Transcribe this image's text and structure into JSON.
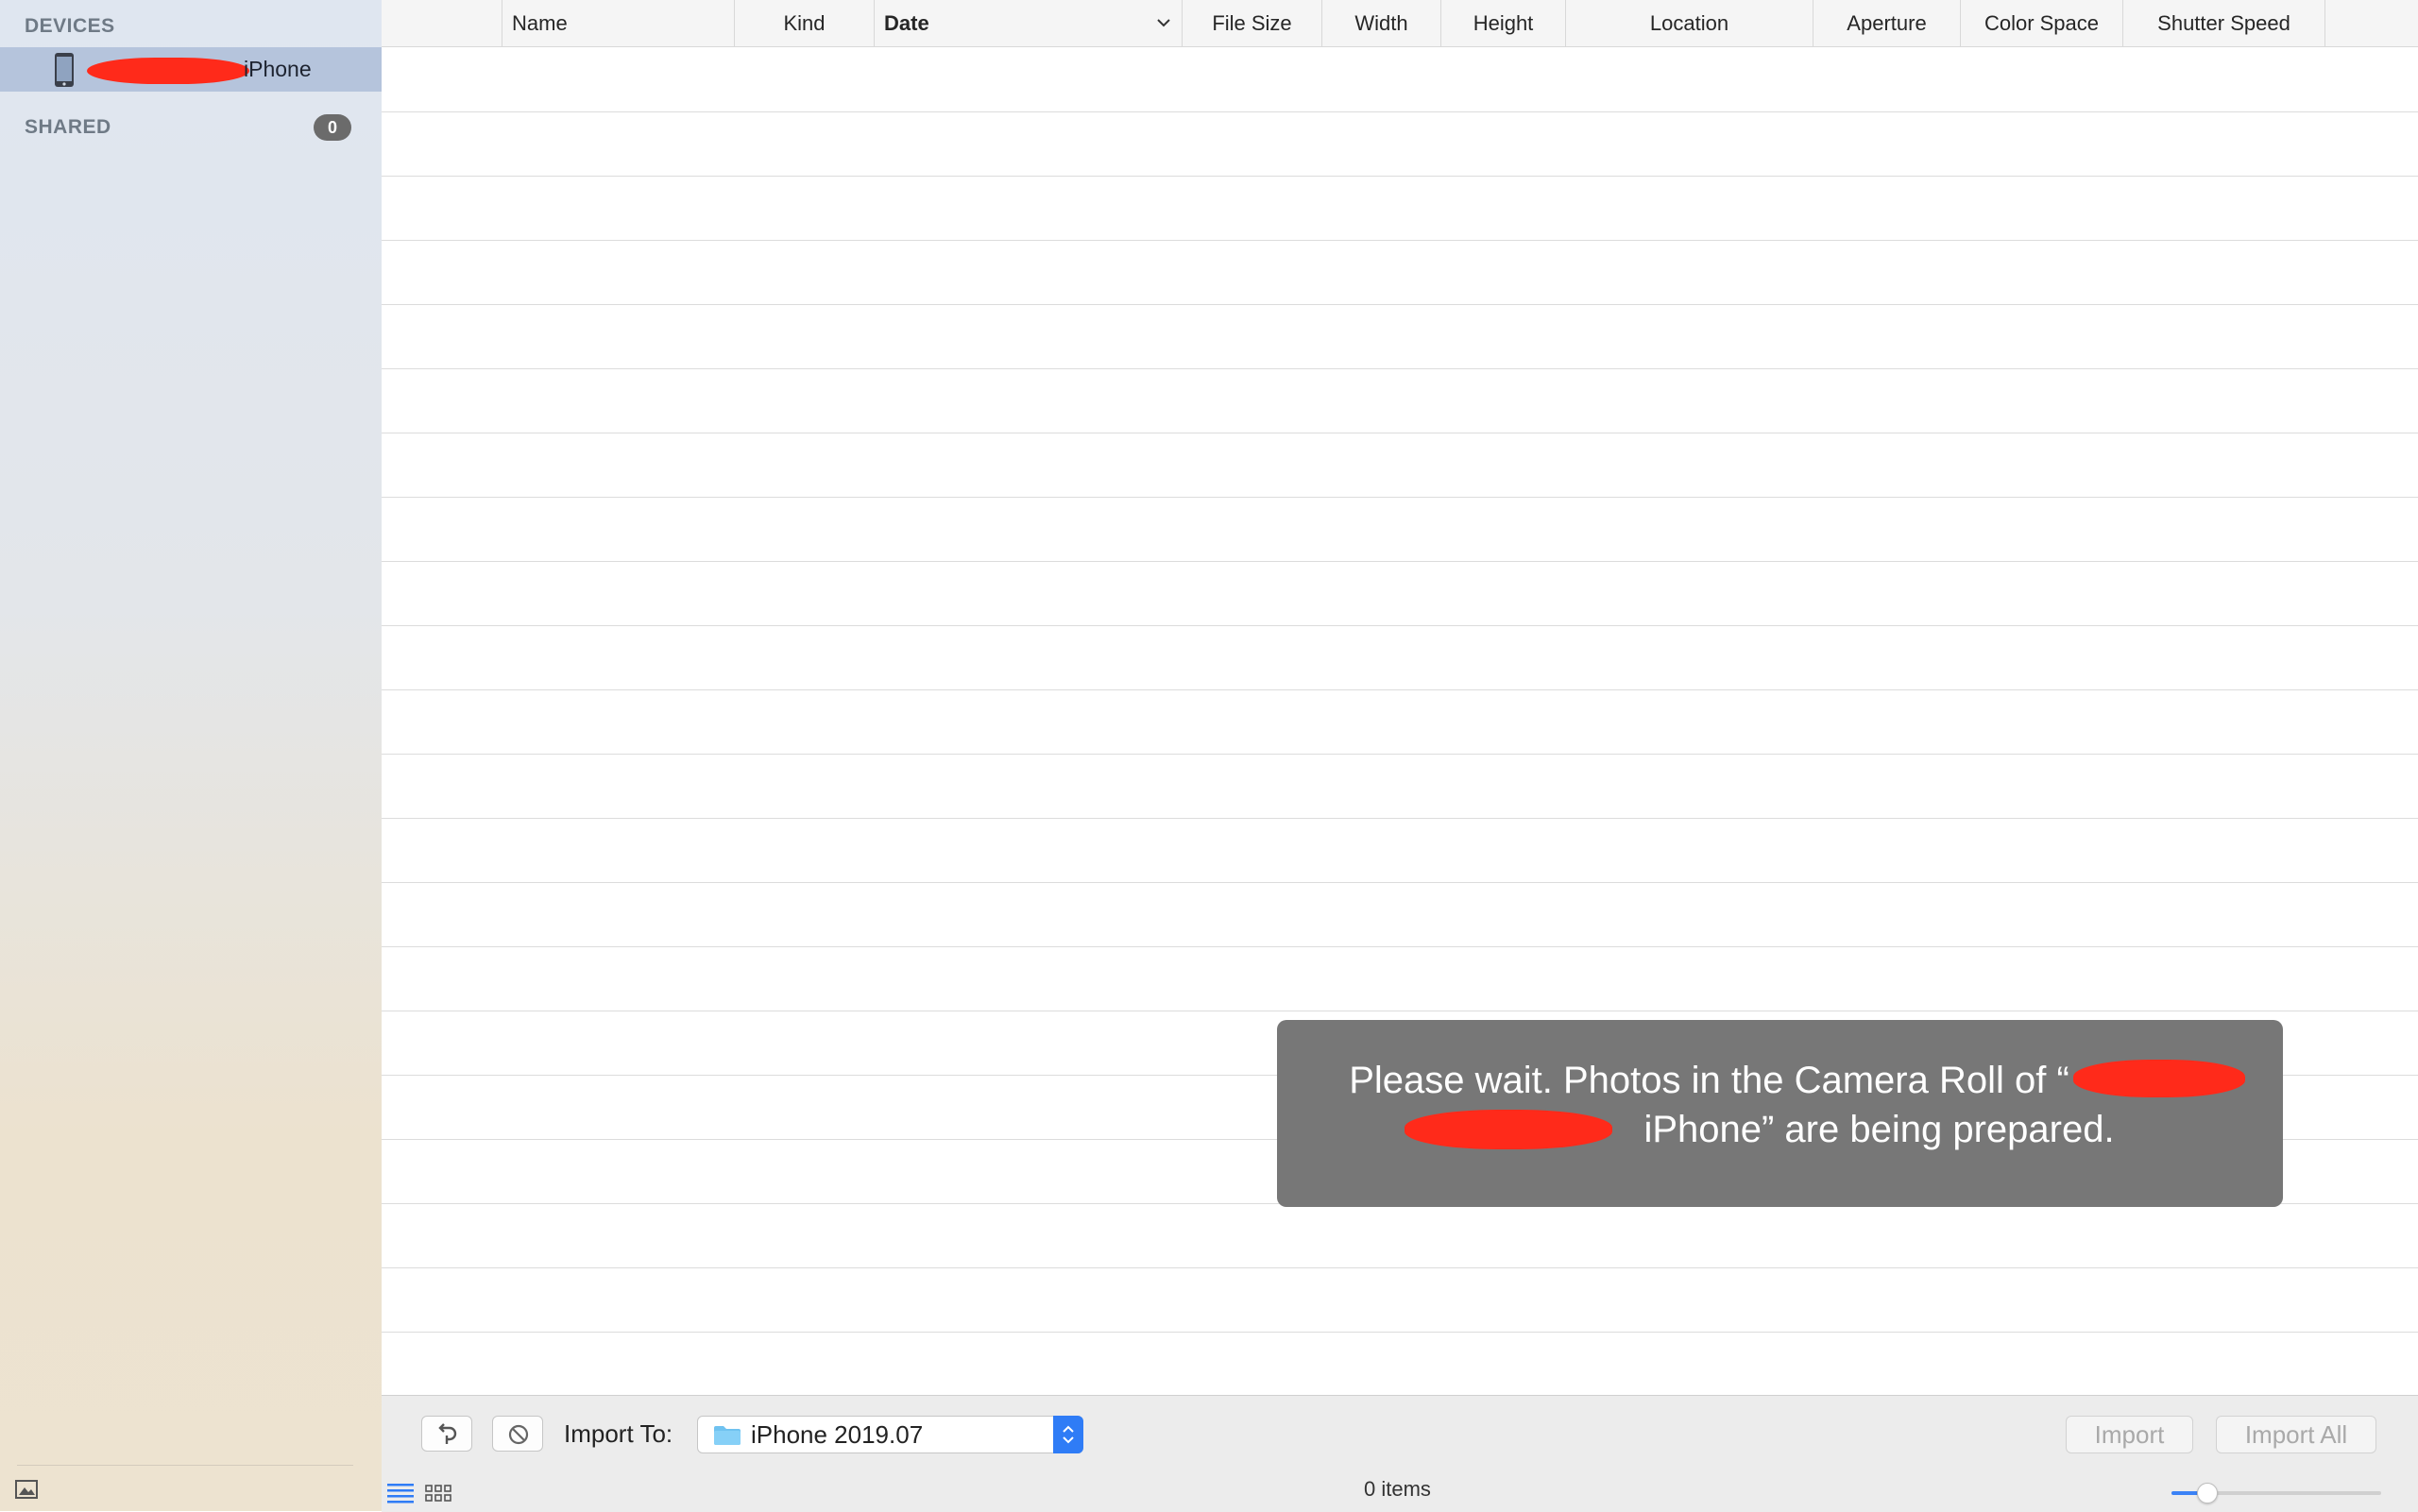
{
  "sidebar": {
    "devices_header": "DEVICES",
    "device_label": "iPhone",
    "shared_header": "SHARED",
    "shared_count": "0"
  },
  "columns": [
    {
      "label": ""
    },
    {
      "label": "Name"
    },
    {
      "label": "Kind"
    },
    {
      "label": "Date"
    },
    {
      "label": "File Size"
    },
    {
      "label": "Width"
    },
    {
      "label": "Height"
    },
    {
      "label": "Location"
    },
    {
      "label": "Aperture"
    },
    {
      "label": "Color Space"
    },
    {
      "label": "Shutter Speed"
    }
  ],
  "overlay": {
    "line1": "Please wait. Photos in the Camera Roll of “",
    "line2": "iPhone” are being prepared."
  },
  "bottom": {
    "import_to_label": "Import To:",
    "destination": "iPhone 2019.07",
    "import_label": "Import",
    "import_all_label": "Import All",
    "items_count": "0 items",
    "thumbnail_size_fraction": 0.17
  },
  "colors": {
    "accent": "#2f7cf6",
    "selection": "#b5c4dc",
    "overlay_bg": "#777777",
    "redaction": "#ff2a1a"
  }
}
